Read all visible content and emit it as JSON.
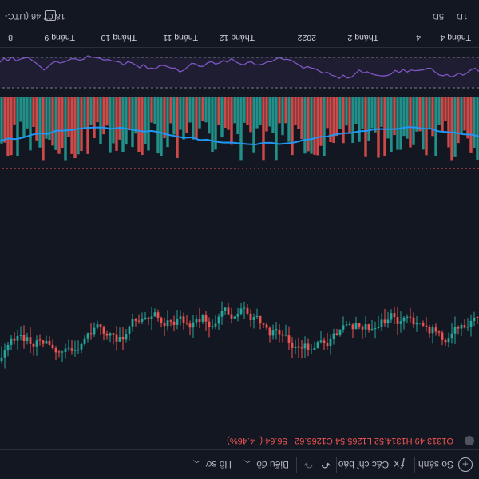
{
  "toolbar": {
    "compare_label": "So sánh",
    "indicators_label": "Các chỉ báo",
    "chart_type_label": "Biểu đồ",
    "templates_label": "Hồ sơ",
    "undo_icon": "undo-icon",
    "redo_icon": "redo-icon"
  },
  "ohlc": {
    "o": "O1313.49",
    "h": "H1314.52",
    "l": "L1265.54",
    "c": "C1266.62",
    "change": "−56.64 (−4.46%)",
    "color_up": "#ef5350"
  },
  "time_axis": {
    "labels": [
      "8",
      "Tháng 9",
      "Tháng 10",
      "Tháng 11",
      "Tháng 12",
      "2022",
      "Tháng 2",
      "4",
      "Tháng 4"
    ]
  },
  "status": {
    "clock": "18:07:46 (UTC-"
  },
  "bottom_toolbar": {
    "tab1": "1D",
    "tab2": "5D"
  },
  "colors": {
    "up": "#26a69a",
    "down": "#ef5350",
    "rsi": "#7e57c2",
    "ma": "#2196f3",
    "bg": "#131722"
  }
}
